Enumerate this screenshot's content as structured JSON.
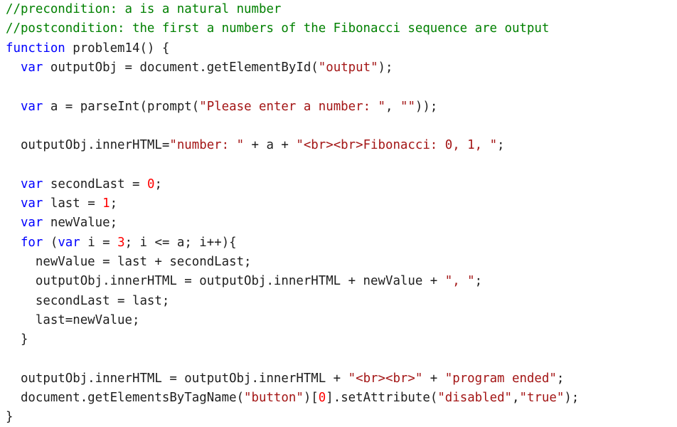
{
  "colors": {
    "comment": "#008000",
    "keyword": "#0000ff",
    "string": "#a31515",
    "number": "#ff0000",
    "plain": "#1e1e1e",
    "background": "#ffffff"
  },
  "code_lines": [
    [
      {
        "t": "c",
        "v": "//precondition: a is a natural number"
      }
    ],
    [
      {
        "t": "c",
        "v": "//postcondition: the first a numbers of the Fibonacci sequence are output"
      }
    ],
    [
      {
        "t": "k",
        "v": "function"
      },
      {
        "t": "p",
        "v": " problem14() {"
      }
    ],
    [
      {
        "t": "p",
        "v": "  "
      },
      {
        "t": "k",
        "v": "var"
      },
      {
        "t": "p",
        "v": " outputObj = document.getElementById("
      },
      {
        "t": "s",
        "v": "\"output\""
      },
      {
        "t": "p",
        "v": ");"
      }
    ],
    [],
    [
      {
        "t": "p",
        "v": "  "
      },
      {
        "t": "k",
        "v": "var"
      },
      {
        "t": "p",
        "v": " a = parseInt(prompt("
      },
      {
        "t": "s",
        "v": "\"Please enter a number: \""
      },
      {
        "t": "p",
        "v": ", "
      },
      {
        "t": "s",
        "v": "\"\""
      },
      {
        "t": "p",
        "v": "));"
      }
    ],
    [],
    [
      {
        "t": "p",
        "v": "  outputObj.innerHTML="
      },
      {
        "t": "s",
        "v": "\"number: \""
      },
      {
        "t": "p",
        "v": " + a + "
      },
      {
        "t": "s",
        "v": "\"<br><br>Fibonacci: 0, 1, \""
      },
      {
        "t": "p",
        "v": ";"
      }
    ],
    [],
    [
      {
        "t": "p",
        "v": "  "
      },
      {
        "t": "k",
        "v": "var"
      },
      {
        "t": "p",
        "v": " secondLast = "
      },
      {
        "t": "n",
        "v": "0"
      },
      {
        "t": "p",
        "v": ";"
      }
    ],
    [
      {
        "t": "p",
        "v": "  "
      },
      {
        "t": "k",
        "v": "var"
      },
      {
        "t": "p",
        "v": " last = "
      },
      {
        "t": "n",
        "v": "1"
      },
      {
        "t": "p",
        "v": ";"
      }
    ],
    [
      {
        "t": "p",
        "v": "  "
      },
      {
        "t": "k",
        "v": "var"
      },
      {
        "t": "p",
        "v": " newValue;"
      }
    ],
    [
      {
        "t": "p",
        "v": "  "
      },
      {
        "t": "k",
        "v": "for"
      },
      {
        "t": "p",
        "v": " ("
      },
      {
        "t": "k",
        "v": "var"
      },
      {
        "t": "p",
        "v": " i = "
      },
      {
        "t": "n",
        "v": "3"
      },
      {
        "t": "p",
        "v": "; i <= a; i++){"
      }
    ],
    [
      {
        "t": "p",
        "v": "    newValue = last + secondLast;"
      }
    ],
    [
      {
        "t": "p",
        "v": "    outputObj.innerHTML = outputObj.innerHTML + newValue + "
      },
      {
        "t": "s",
        "v": "\", \""
      },
      {
        "t": "p",
        "v": ";"
      }
    ],
    [
      {
        "t": "p",
        "v": "    secondLast = last;"
      }
    ],
    [
      {
        "t": "p",
        "v": "    last=newValue;"
      }
    ],
    [
      {
        "t": "p",
        "v": "  }"
      }
    ],
    [],
    [
      {
        "t": "p",
        "v": "  outputObj.innerHTML = outputObj.innerHTML + "
      },
      {
        "t": "s",
        "v": "\"<br><br>\""
      },
      {
        "t": "p",
        "v": " + "
      },
      {
        "t": "s",
        "v": "\"program ended\""
      },
      {
        "t": "p",
        "v": ";"
      }
    ],
    [
      {
        "t": "p",
        "v": "  document.getElementsByTagName("
      },
      {
        "t": "s",
        "v": "\"button\""
      },
      {
        "t": "p",
        "v": ")["
      },
      {
        "t": "n",
        "v": "0"
      },
      {
        "t": "p",
        "v": "].setAttribute("
      },
      {
        "t": "s",
        "v": "\"disabled\""
      },
      {
        "t": "p",
        "v": ","
      },
      {
        "t": "s",
        "v": "\"true\""
      },
      {
        "t": "p",
        "v": ");"
      }
    ],
    [
      {
        "t": "p",
        "v": "}"
      }
    ]
  ]
}
